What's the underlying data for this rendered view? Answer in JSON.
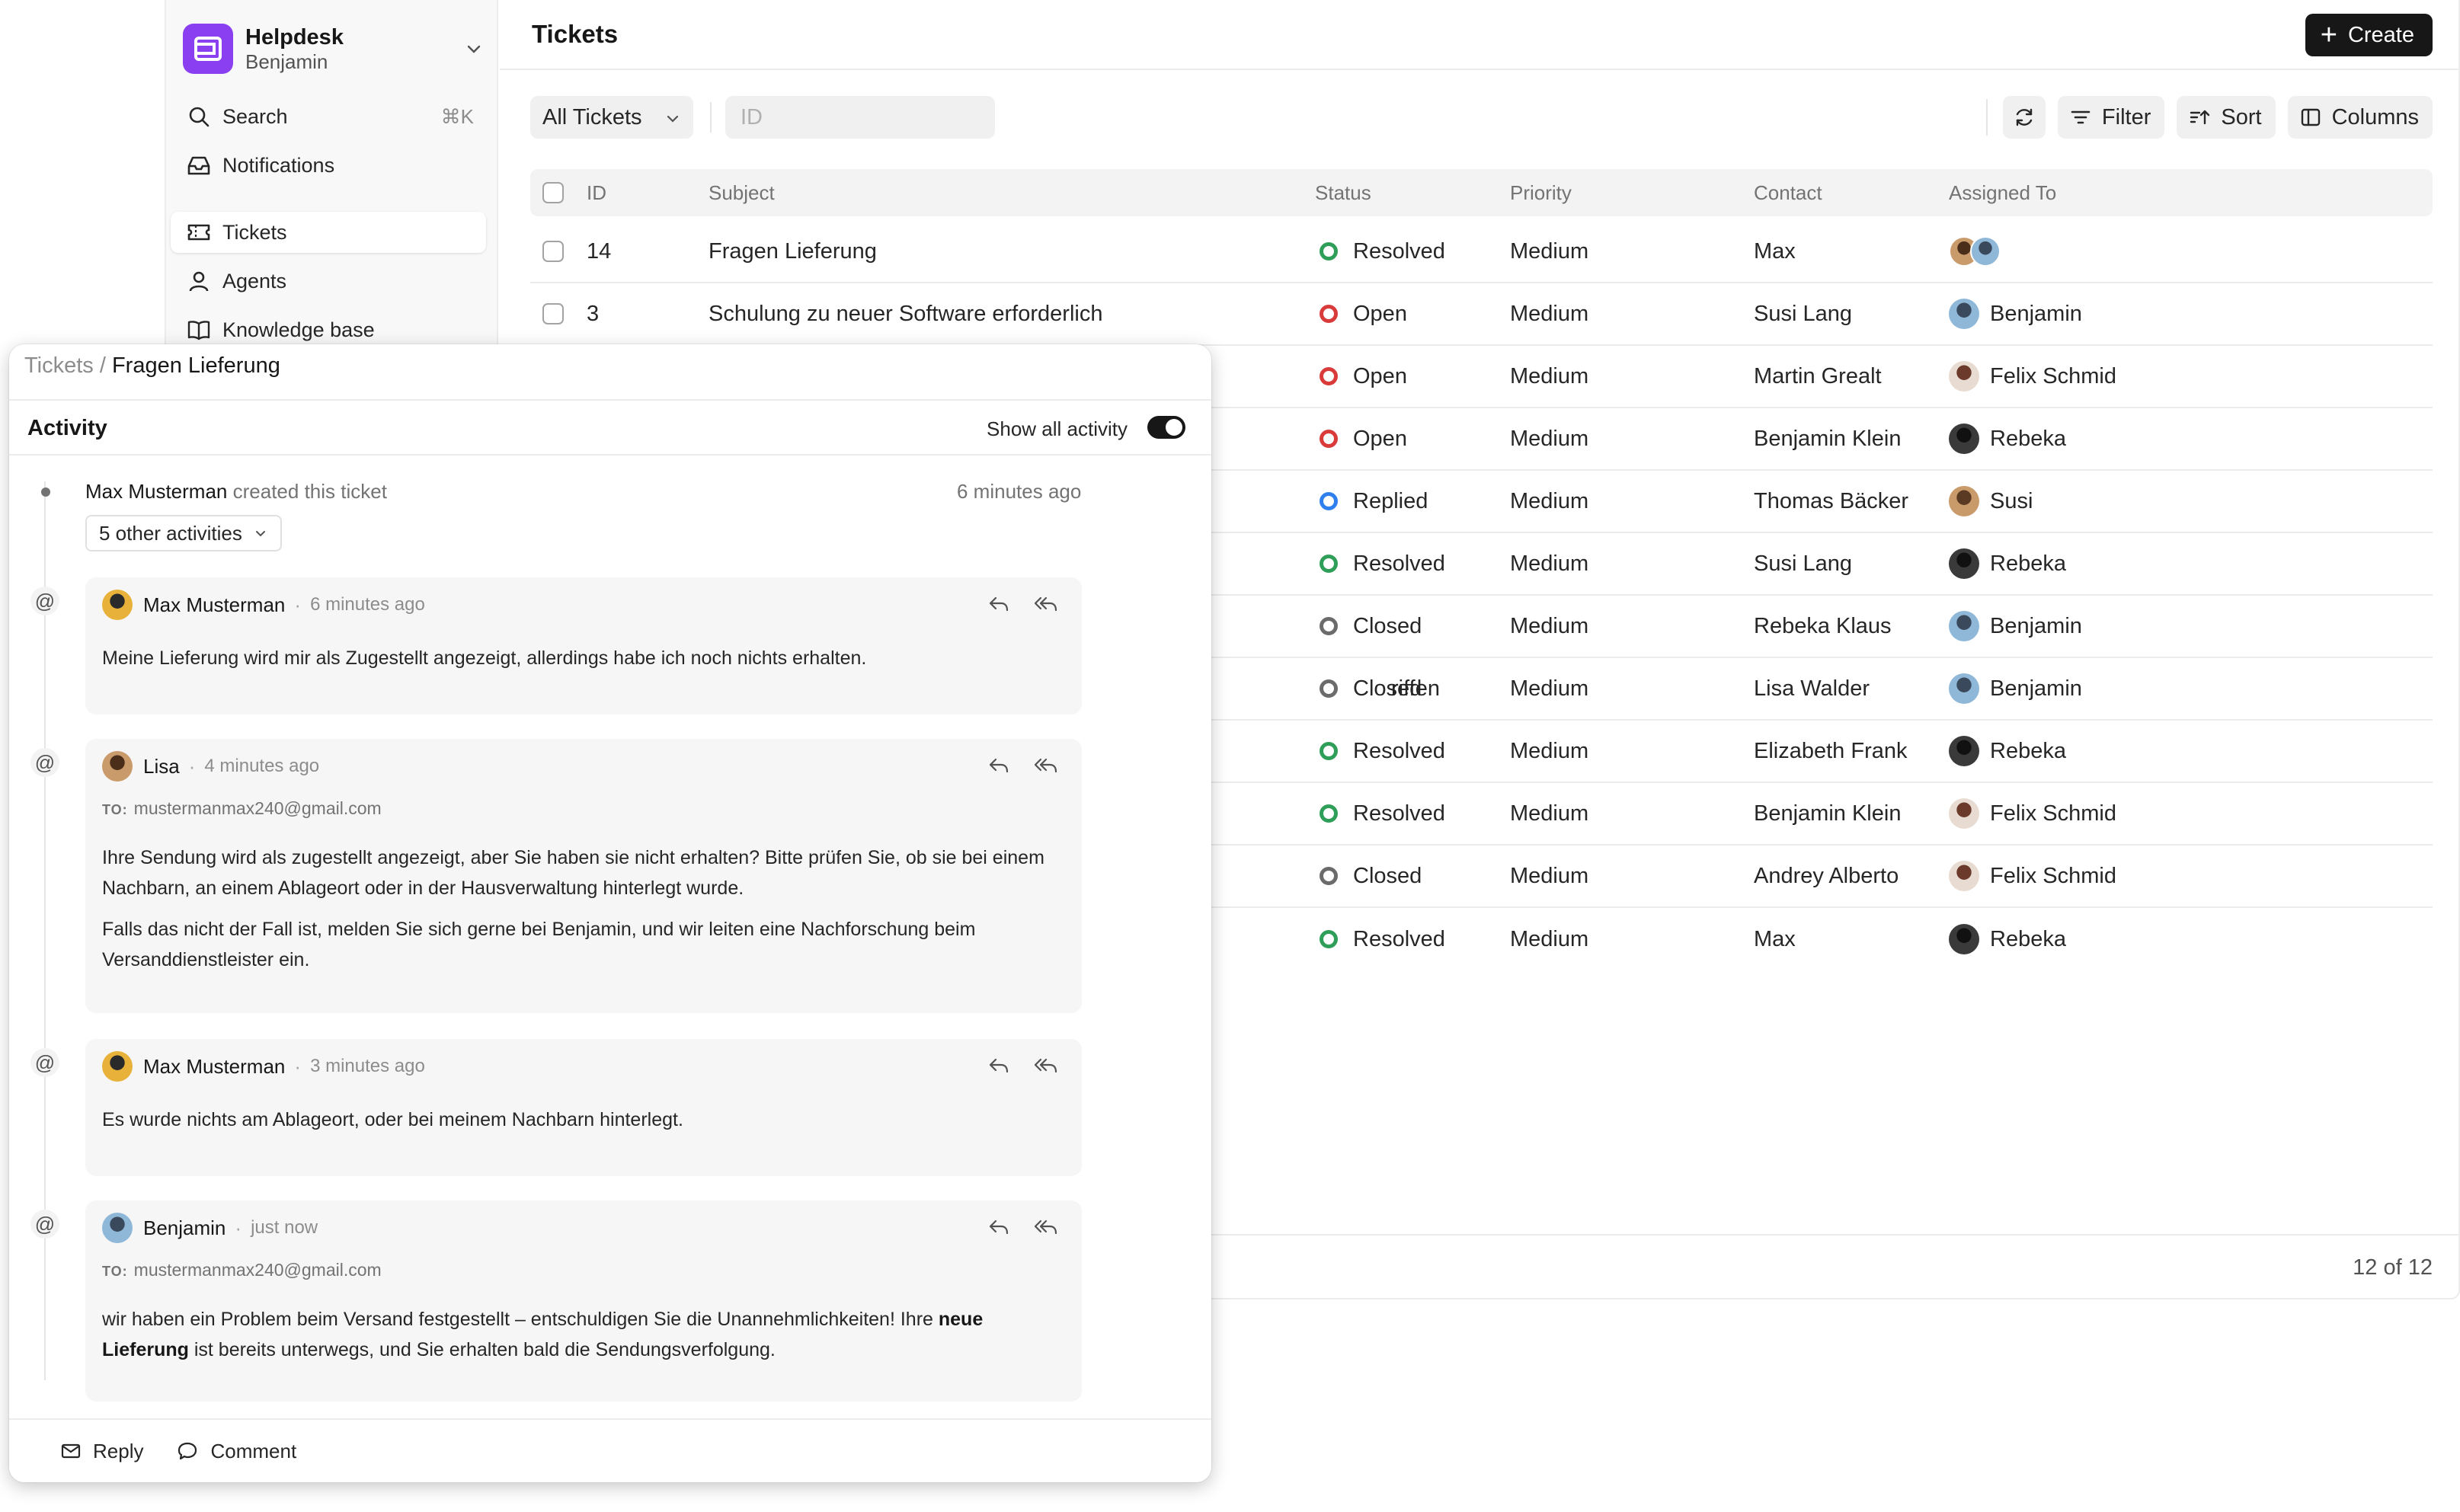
{
  "app": {
    "brand_title": "Helpdesk",
    "brand_user": "Benjamin",
    "sidebar": {
      "items": [
        {
          "label": "Search",
          "icon": "search-icon",
          "shortcut": "⌘K"
        },
        {
          "label": "Notifications",
          "icon": "inbox-icon"
        },
        {
          "label": "Tickets",
          "icon": "ticket-icon",
          "active": true
        },
        {
          "label": "Agents",
          "icon": "user-icon"
        },
        {
          "label": "Knowledge base",
          "icon": "book-icon"
        }
      ]
    },
    "header": {
      "title": "Tickets",
      "create_label": "Create"
    },
    "toolbar": {
      "view_select": "All Tickets",
      "id_placeholder": "ID",
      "filter_label": "Filter",
      "sort_label": "Sort",
      "columns_label": "Columns"
    },
    "table": {
      "headers": {
        "id": "ID",
        "subject": "Subject",
        "status": "Status",
        "priority": "Priority",
        "contact": "Contact",
        "assigned": "Assigned To"
      },
      "rows": [
        {
          "id": "14",
          "subject": "Fragen Lieferung",
          "status": "Resolved",
          "priority": "Medium",
          "contact": "Max",
          "assigned": ""
        },
        {
          "id": "3",
          "subject": "Schulung zu neuer Software erforderlich",
          "status": "Open",
          "priority": "Medium",
          "contact": "Susi Lang",
          "assigned": "Benjamin"
        },
        {
          "id": "",
          "subject": "",
          "status": "Open",
          "priority": "Medium",
          "contact": "Martin Grealt",
          "assigned": "Felix Schmid"
        },
        {
          "id": "",
          "subject": "",
          "status": "Open",
          "priority": "Medium",
          "contact": "Benjamin Klein",
          "assigned": "Rebeka"
        },
        {
          "id": "",
          "subject": "",
          "status": "Replied",
          "priority": "Medium",
          "contact": "Thomas Bäcker",
          "assigned": "Susi"
        },
        {
          "id": "",
          "subject": "",
          "status": "Resolved",
          "priority": "Medium",
          "contact": "Susi Lang",
          "assigned": "Rebeka"
        },
        {
          "id": "",
          "subject": "",
          "status": "Closed",
          "priority": "Medium",
          "contact": "Rebeka Klaus",
          "assigned": "Benjamin"
        },
        {
          "id": "",
          "subject": "riffen",
          "status": "Closed",
          "priority": "Medium",
          "contact": "Lisa Walder",
          "assigned": "Benjamin"
        },
        {
          "id": "",
          "subject": "",
          "status": "Resolved",
          "priority": "Medium",
          "contact": "Elizabeth Frank",
          "assigned": "Rebeka"
        },
        {
          "id": "",
          "subject": "",
          "status": "Resolved",
          "priority": "Medium",
          "contact": "Benjamin Klein",
          "assigned": "Felix Schmid"
        },
        {
          "id": "",
          "subject": "",
          "status": "Closed",
          "priority": "Medium",
          "contact": "Andrey Alberto",
          "assigned": "Felix Schmid"
        },
        {
          "id": "",
          "subject": "",
          "status": "Resolved",
          "priority": "Medium",
          "contact": "Max",
          "assigned": "Rebeka"
        }
      ]
    },
    "pagination": "12 of 12",
    "status_colors": {
      "Resolved": "#2f9e59",
      "Open": "#d93b3b",
      "Replied": "#2f80ed",
      "Closed": "#6b6b6b"
    }
  },
  "panel": {
    "breadcrumb_root": "Tickets",
    "breadcrumb_sep": "/",
    "breadcrumb_current": "Fragen Lieferung",
    "activity_title": "Activity",
    "show_all_label": "Show all activity",
    "created": {
      "author": "Max Musterman",
      "text": "created this ticket",
      "time": "6 minutes ago"
    },
    "other_activities": "5 other activities",
    "messages": [
      {
        "author": "Max Musterman",
        "time": "6 minutes ago",
        "to": "",
        "paragraphs": [
          "Meine Lieferung wird mir als Zugestellt angezeigt, allerdings habe ich noch nichts erhalten."
        ]
      },
      {
        "author": "Lisa",
        "time": "4 minutes ago",
        "to": "mustermanmax240@gmail.com",
        "paragraphs": [
          "Ihre Sendung wird als zugestellt angezeigt, aber Sie haben sie nicht erhalten? Bitte prüfen Sie, ob sie bei einem Nachbarn, an einem Ablageort oder in der Hausverwaltung hinterlegt wurde.",
          "Falls das nicht der Fall ist, melden Sie sich gerne bei Benjamin, und wir leiten eine Nachforschung beim Versanddienstleister ein."
        ]
      },
      {
        "author": "Max Musterman",
        "time": "3 minutes ago",
        "to": "",
        "paragraphs": [
          "Es wurde nichts am Ablageort, oder bei meinem Nachbarn hinterlegt."
        ]
      },
      {
        "author": "Benjamin",
        "time": "just now",
        "to": "mustermanmax240@gmail.com",
        "paragraphs": [],
        "rich": {
          "before": "wir haben ein Problem beim Versand festgestellt – entschuldigen Sie die Unannehmlichkeiten! Ihre ",
          "bold": "neue Lieferung",
          "after": " ist bereits unterwegs, und Sie erhalten bald die Sendungsverfolgung."
        }
      }
    ],
    "to_label": "TO:",
    "dot_sep": "·",
    "footer": {
      "reply_label": "Reply",
      "comment_label": "Comment"
    }
  }
}
